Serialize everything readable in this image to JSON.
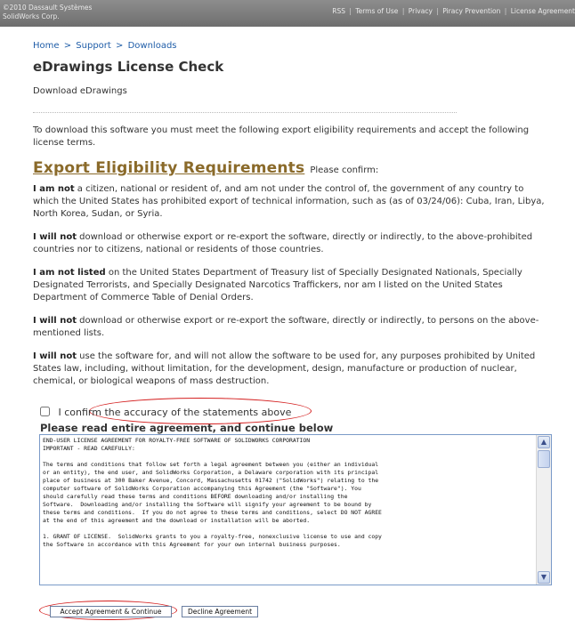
{
  "header": {
    "copyright_line1": "©2010 Dassault Systèmes",
    "copyright_line2": "SolidWorks Corp.",
    "links": [
      "RSS",
      "Terms of Use",
      "Privacy",
      "Piracy Prevention",
      "License Agreement"
    ],
    "separator": "|"
  },
  "breadcrumb": {
    "items": [
      "Home",
      "Support",
      "Downloads"
    ],
    "separator": ">"
  },
  "page": {
    "title": "eDrawings License Check",
    "subtitle": "Download eDrawings",
    "intro": "To download this software you must meet the following export eligibility requirements and accept the following license terms."
  },
  "eligibility": {
    "heading": "Export Eligibility Requirements",
    "please_confirm": "Please confirm:",
    "statements": [
      {
        "bold": "I am not",
        "text": " a citizen, national or resident of, and am not under the control of, the government of any country to which the United States has prohibited export of technical information, such as (as of 03/24/06): Cuba, Iran, Libya, North Korea, Sudan, or Syria."
      },
      {
        "bold": "I will not",
        "text": " download or otherwise export or re-export the software, directly or indirectly, to the above-prohibited countries nor to citizens, national or residents of those countries."
      },
      {
        "bold": "I am not listed",
        "text": " on the United States Department of Treasury list of Specially Designated Nationals, Specially Designated Terrorists, and Specially Designated Narcotics Traffickers, nor am I listed on the United States Department of Commerce Table of Denial Orders."
      },
      {
        "bold": "I will not",
        "text": " download or otherwise export or re-export the software, directly or indirectly, to persons on the above-mentioned lists."
      },
      {
        "bold": "I will not",
        "text": " use the software for, and will not allow the software to be used for, any purposes prohibited by United States law, including, without limitation, for the development, design, manufacture or production of nuclear, chemical, or biological weapons of mass destruction."
      }
    ],
    "confirm_label": "I confirm the accuracy of the statements above",
    "confirm_checked": false
  },
  "agreement": {
    "heading": "Please read entire agreement, and continue below",
    "text": "END-USER LICENSE AGREEMENT FOR ROYALTY-FREE SOFTWARE OF SOLIDWORKS CORPORATION\nIMPORTANT - READ CAREFULLY:\n\nThe terms and conditions that follow set forth a legal agreement between you (either an individual\nor an entity), the end user, and SolidWorks Corporation, a Delaware corporation with its principal\nplace of business at 300 Baker Avenue, Concord, Massachusetts 01742 (\"SolidWorks\") relating to the\ncomputer software of SolidWorks Corporation accompanying this Agreement (the \"Software\"). You\nshould carefully read these terms and conditions BEFORE downloading and/or installing the\nSoftware.  Downloading and/or installing the Software will signify your agreement to be bound by\nthese terms and conditions.  If you do not agree to these terms and conditions, select DO NOT AGREE\nat the end of this agreement and the download or installation will be aborted.\n\n1. GRANT OF LICENSE.  SolidWorks grants to you a royalty-free, nonexclusive license to use and copy\nthe Software in accordance with this Agreement for your own internal business purposes.",
    "accept_label": "Accept Agreement & Continue",
    "decline_label": "Decline Agreement"
  },
  "colors": {
    "header_bg": "#7d7d7d",
    "link": "#1f5da8",
    "heading_gold": "#8a6a2a",
    "annotation_red": "#d41e1e"
  }
}
